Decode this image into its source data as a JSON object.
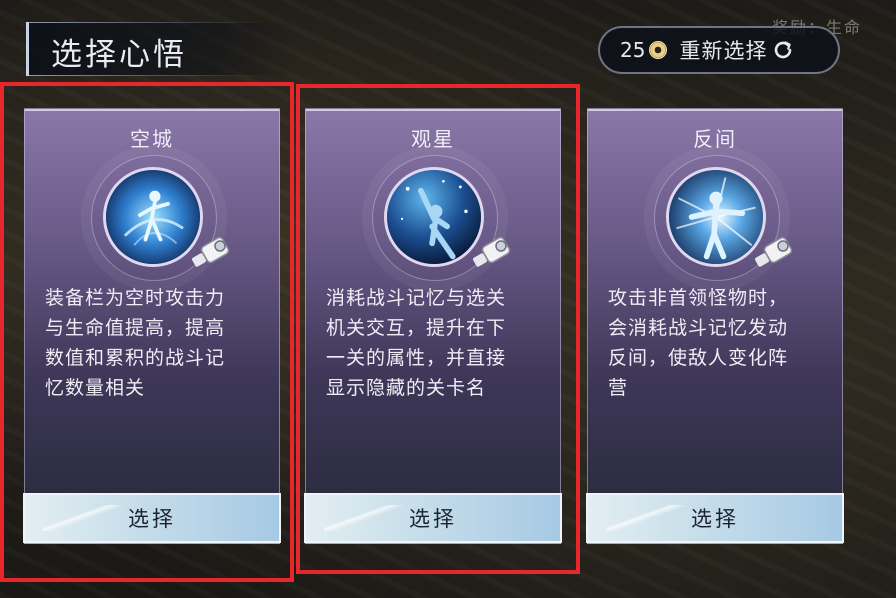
{
  "header": {
    "title": "选择心悟",
    "reward_text": "奖励：生命"
  },
  "reroll": {
    "count": "25",
    "label": "重新选择",
    "coin_icon": "coin-icon",
    "refresh_icon": "refresh-icon"
  },
  "cards": [
    {
      "title": "空城",
      "icon": "spirit-figure-emblem",
      "desc_lines": [
        "装备栏为空时攻击力",
        "与生命值提高，提高",
        "数值和累积的战斗记",
        "忆数量相关"
      ],
      "button_label": "选择",
      "highlighted": true
    },
    {
      "title": "观星",
      "icon": "stargazer-emblem",
      "desc_lines": [
        "消耗战斗记忆与选关",
        "机关交互，提升在下",
        "一关的属性，并直接",
        "显示隐藏的关卡名"
      ],
      "button_label": "选择",
      "highlighted": true
    },
    {
      "title": "反间",
      "icon": "burst-figure-emblem",
      "desc_lines": [
        "攻击非首领怪物时，",
        "会消耗战斗记忆发动",
        "反间，使敌人变化阵",
        "营"
      ],
      "button_label": "选择",
      "highlighted": false
    }
  ],
  "colors": {
    "highlight": "#e8262b",
    "card_top": "#8a78a8",
    "button": "#a6c9e4"
  }
}
